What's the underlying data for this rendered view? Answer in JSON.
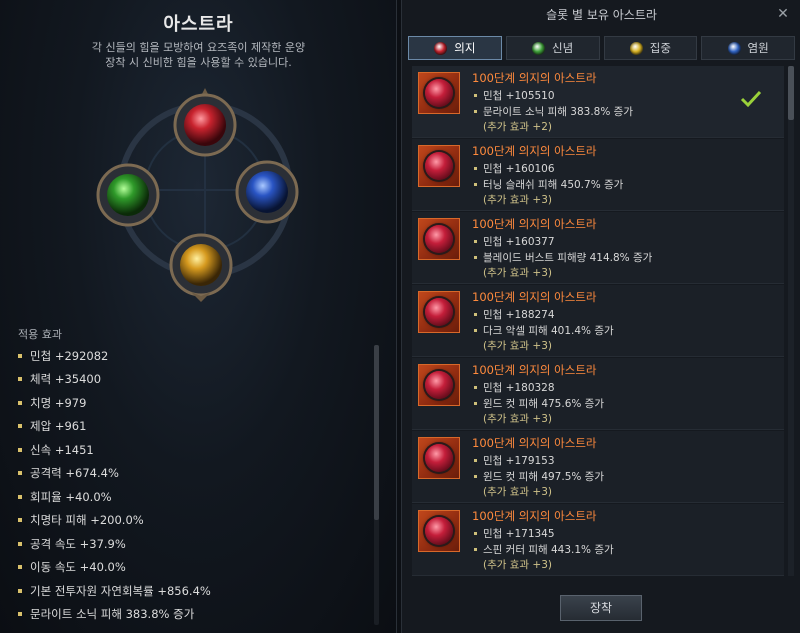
{
  "left": {
    "title": "아스트라",
    "desc_line1": "각 신들의 힘을 모방하여 요즈족이 제작한 운양",
    "desc_line2": "장착 시 신비한 힘을 사용할 수 있습니다.",
    "effects_label": "적용 효과",
    "effects": [
      "민첩 +292082",
      "체력 +35400",
      "치명 +979",
      "제압 +961",
      "신속 +1451",
      "공격력 +674.4%",
      "회피율 +40.0%",
      "치명타 피해 +200.0%",
      "공격 속도 +37.9%",
      "이동 속도 +40.0%",
      "기본 전투자원 자연회복률 +856.4%",
      "문라이트 소닉 피해 383.8% 증가"
    ]
  },
  "right": {
    "header": "슬롯 별 보유 아스트라",
    "close": "✕",
    "tabs": [
      {
        "label": "의지",
        "color": "#c8232e",
        "active": true
      },
      {
        "label": "신념",
        "color": "#3fa33a",
        "active": false
      },
      {
        "label": "집중",
        "color": "#d8b323",
        "active": false
      },
      {
        "label": "염원",
        "color": "#2f63c4",
        "active": false
      }
    ],
    "items": [
      {
        "name": "100단계 의지의 아스트라",
        "stat": "민첩 +105510",
        "skill": "문라이트 소닉 피해 383.8% 증가",
        "extra": "(추가 효과 +2)",
        "equipped": true
      },
      {
        "name": "100단계 의지의 아스트라",
        "stat": "민첩 +160106",
        "skill": "터닝 슬래쉬 피해 450.7% 증가",
        "extra": "(추가 효과 +3)",
        "equipped": false
      },
      {
        "name": "100단계 의지의 아스트라",
        "stat": "민첩 +160377",
        "skill": "블레이드 버스트 피해량 414.8% 증가",
        "extra": "(추가 효과 +3)",
        "equipped": false
      },
      {
        "name": "100단계 의지의 아스트라",
        "stat": "민첩 +188274",
        "skill": "다크 악셀 피해 401.4% 증가",
        "extra": "(추가 효과 +3)",
        "equipped": false
      },
      {
        "name": "100단계 의지의 아스트라",
        "stat": "민첩 +180328",
        "skill": "윈드 컷 피해 475.6% 증가",
        "extra": "(추가 효과 +3)",
        "equipped": false
      },
      {
        "name": "100단계 의지의 아스트라",
        "stat": "민첩 +179153",
        "skill": "윈드 컷 피해 497.5% 증가",
        "extra": "(추가 효과 +3)",
        "equipped": false
      },
      {
        "name": "100단계 의지의 아스트라",
        "stat": "민첩 +171345",
        "skill": "스핀 커터 피해 443.1% 증가",
        "extra": "(추가 효과 +3)",
        "equipped": false
      }
    ],
    "equip_label": "장착"
  },
  "icons": {
    "close": "close-icon",
    "check": "check-icon",
    "gem": "red-gem-icon"
  }
}
